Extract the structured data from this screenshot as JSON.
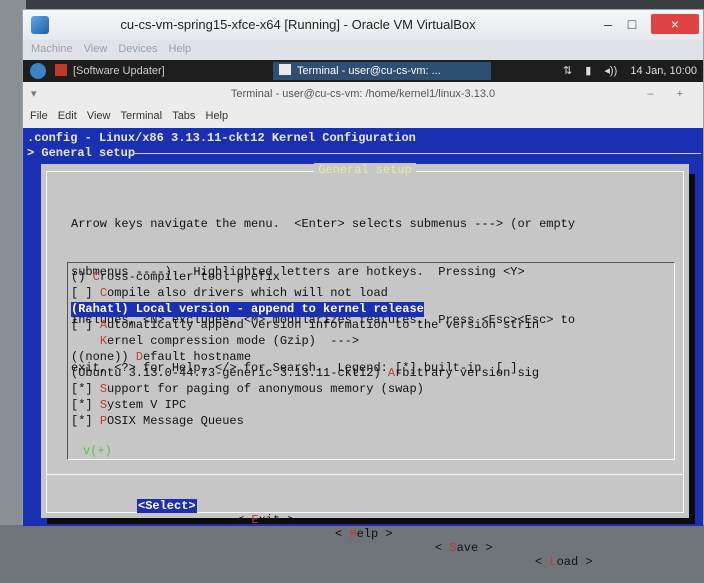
{
  "vbox": {
    "title": "cu-cs-vm-spring15-xfce-x64 [Running] - Oracle VM VirtualBox",
    "menu": [
      "Machine",
      "View",
      "Devices",
      "Help"
    ],
    "window_buttons": {
      "minimize": "–",
      "maximize": "□",
      "close": "×"
    }
  },
  "xfce_panel": {
    "task1": "[Software Updater]",
    "task2": "Terminal - user@cu-cs-vm: ...",
    "tray_network": "⇅",
    "tray_battery": "▮",
    "tray_volume": "◂))",
    "clock": "14 Jan, 10:00"
  },
  "terminal": {
    "title": "Terminal - user@cu-cs-vm: /home/kernel1/linux-3.13.0",
    "left_glyph": "▾",
    "right_glyphs": "– +",
    "menu": [
      "File",
      "Edit",
      "View",
      "Terminal",
      "Tabs",
      "Help"
    ]
  },
  "kconfig": {
    "header1": ".config - Linux/x86 3.13.11-ckt12 Kernel Configuration",
    "header2": "> General setup",
    "dialog_title": "General setup",
    "help_lines": [
      "Arrow keys navigate the menu.  <Enter> selects submenus ---> (or empty",
      "submenus ----).  Highlighted letters are hotkeys.  Pressing <Y>",
      "includes, <N> excludes, <M> modularizes features.  Press <Esc><Esc> to",
      "exit, <?> for Help, </> for Search.  Legend: [*] built-in  [ ]"
    ],
    "items": [
      {
        "prefix": "() ",
        "hotkey": "C",
        "rest": "ross-compiler tool prefix"
      },
      {
        "prefix": "[ ] ",
        "hotkey": "C",
        "rest": "ompile also drivers which will not load"
      },
      {
        "prefix": "",
        "hotkey": "",
        "rest": "(Rahatl) Local version - append to kernel release"
      },
      {
        "prefix": "[ ] ",
        "hotkey": "A",
        "rest": "utomatically append version information to the version strin"
      },
      {
        "prefix": "    ",
        "hotkey": "K",
        "rest": "ernel compression mode (Gzip)  --->"
      },
      {
        "prefix": "((none)) ",
        "hotkey": "D",
        "rest": "efault hostname"
      },
      {
        "prefix": "(Ubuntu 3.13.0-44.73-generic 3.13.11-ckt12) ",
        "hotkey": "A",
        "rest": "rbitrary version sig"
      },
      {
        "prefix": "[*] ",
        "hotkey": "S",
        "rest": "upport for paging of anonymous memory (swap)"
      },
      {
        "prefix": "[*] ",
        "hotkey": "S",
        "rest": "ystem V IPC"
      },
      {
        "prefix": "[*] ",
        "hotkey": "P",
        "rest": "OSIX Message Queues"
      }
    ],
    "more_indicator": "v(+)",
    "buttons": {
      "select": "<Select>",
      "exit_pre": "< ",
      "exit_hk": "E",
      "exit_rest": "xit >",
      "help_pre": "< ",
      "help_hk": "H",
      "help_rest": "elp >",
      "save_pre": "< ",
      "save_hk": "S",
      "save_rest": "ave >",
      "load_pre": "< ",
      "load_hk": "L",
      "load_rest": "oad >"
    }
  }
}
